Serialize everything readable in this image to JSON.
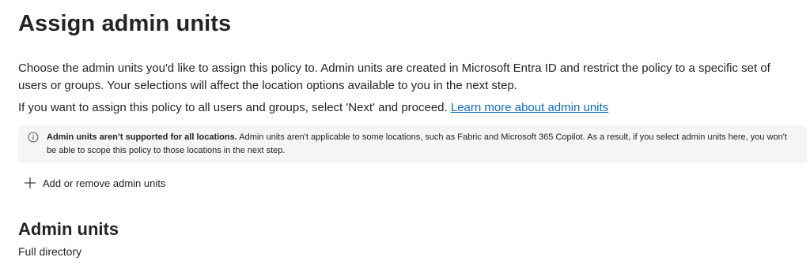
{
  "page": {
    "title": "Assign admin units",
    "description": "Choose the admin units you'd like to assign this policy to. Admin units are created in Microsoft Entra ID and restrict the policy to a specific set of users or groups. Your selections will affect the location options available to you in the next step.",
    "instruction": "If you want to assign this policy to all users and groups, select 'Next' and proceed.",
    "learn_more_link": "Learn more about admin units"
  },
  "info_bar": {
    "icon": "info-icon",
    "bold_text": "Admin units aren’t supported for all locations.",
    "body_text": "Admin units aren't applicable to some locations, such as Fabric and Microsoft 365 Copilot. As a result, if you select admin units here, you won't be able to scope this policy to those locations in the next step."
  },
  "actions": {
    "add_remove_label": "Add or remove admin units",
    "add_icon": "plus-icon"
  },
  "admin_units_section": {
    "heading": "Admin units",
    "value": "Full directory"
  }
}
